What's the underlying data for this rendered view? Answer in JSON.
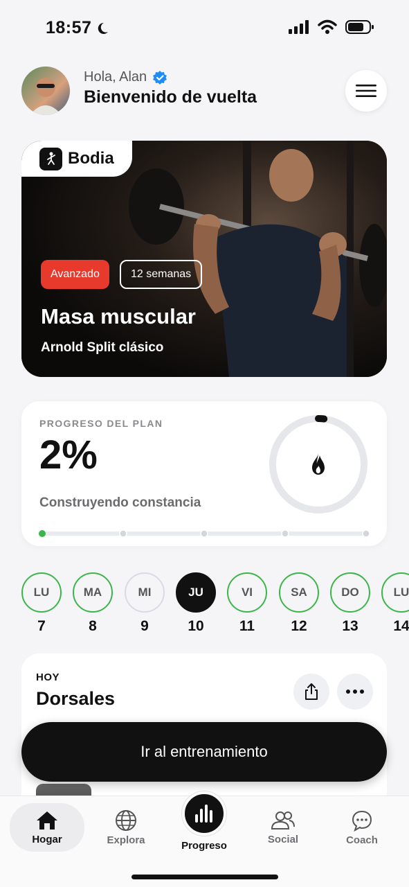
{
  "status_bar": {
    "time": "18:57",
    "icons": [
      "moon-icon",
      "signal-icon",
      "wifi-icon",
      "battery-icon"
    ]
  },
  "header": {
    "greeting": "Hola, Alan",
    "title": "Bienvenido de vuelta",
    "verified_color": "#1d8cf8"
  },
  "hero": {
    "brand": "Bodia",
    "level_tag": "Avanzado",
    "duration_tag": "12 semanas",
    "title": "Masa muscular",
    "subtitle": "Arnold Split clásico",
    "level_color": "#e8392d"
  },
  "progress": {
    "label": "PROGRESO DEL PLAN",
    "value": "2%",
    "fraction": 0.02,
    "caption": "Construyendo constancia",
    "milestones_total": 5,
    "milestones_done": 1,
    "done_color": "#3cb54a"
  },
  "days": [
    {
      "abbr": "LU",
      "num": "7",
      "state": "done"
    },
    {
      "abbr": "MA",
      "num": "8",
      "state": "done"
    },
    {
      "abbr": "MI",
      "num": "9",
      "state": "pending"
    },
    {
      "abbr": "JU",
      "num": "10",
      "state": "today"
    },
    {
      "abbr": "VI",
      "num": "11",
      "state": "done"
    },
    {
      "abbr": "SA",
      "num": "12",
      "state": "done"
    },
    {
      "abbr": "DO",
      "num": "13",
      "state": "done"
    },
    {
      "abbr": "LU",
      "num": "14",
      "state": "done"
    }
  ],
  "today": {
    "kicker": "HOY",
    "title": "Dorsales",
    "cta": "Ir al entrenamiento"
  },
  "nav": {
    "home": "Hogar",
    "explore": "Explora",
    "progress": "Progreso",
    "social": "Social",
    "coach": "Coach"
  }
}
